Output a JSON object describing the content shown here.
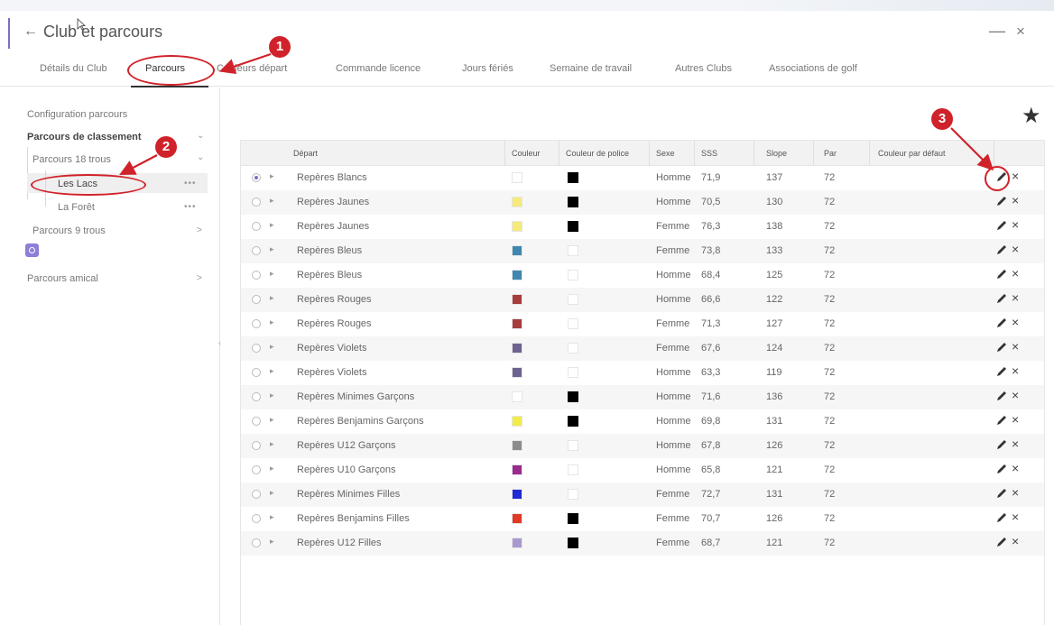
{
  "window": {
    "title": "Club et parcours",
    "back_icon": "arrow-left-icon",
    "minimize_label": "—",
    "close_label": "×"
  },
  "tabs": [
    {
      "label": "Détails du Club",
      "active": false
    },
    {
      "label": "Parcours",
      "active": true
    },
    {
      "label": "Couleurs départ",
      "active": false
    },
    {
      "label": "Commande licence",
      "active": false
    },
    {
      "label": "Jours fériés",
      "active": false
    },
    {
      "label": "Semaine de travail",
      "active": false
    },
    {
      "label": "Autres Clubs",
      "active": false
    },
    {
      "label": "Associations de golf",
      "active": false
    }
  ],
  "sidebar": {
    "heading": "Configuration parcours",
    "items": [
      {
        "label": "Parcours de classement",
        "chevron": "⌄"
      },
      {
        "label": "Parcours 18 trous",
        "chevron": "⌄"
      },
      {
        "label": "Les Lacs",
        "dots": "•••",
        "selected": true
      },
      {
        "label": "La Forêt",
        "dots": "•••"
      },
      {
        "label": "Parcours 9 trous",
        "chevron": ">"
      },
      {
        "label": "Parcours amical",
        "chevron": ">"
      }
    ]
  },
  "table": {
    "headers": [
      "Départ",
      "Couleur",
      "Couleur de police",
      "Sexe",
      "SSS",
      "Slope",
      "Par",
      "Couleur par défaut"
    ],
    "rows": [
      {
        "depart": "Repères Blancs",
        "couleur": "#ffffff",
        "police": "#000000",
        "sexe": "Homme",
        "sss": "71,9",
        "slope": "137",
        "par": "72",
        "checked": true
      },
      {
        "depart": "Repères Jaunes",
        "couleur": "#f5ea7a",
        "police": "#000000",
        "sexe": "Homme",
        "sss": "70,5",
        "slope": "130",
        "par": "72",
        "checked": false
      },
      {
        "depart": "Repères Jaunes",
        "couleur": "#f5ea7a",
        "police": "#000000",
        "sexe": "Femme",
        "sss": "76,3",
        "slope": "138",
        "par": "72",
        "checked": false
      },
      {
        "depart": "Repères Bleus",
        "couleur": "#3f87b0",
        "police": "#ffffff",
        "sexe": "Femme",
        "sss": "73,8",
        "slope": "133",
        "par": "72",
        "checked": false
      },
      {
        "depart": "Repères Bleus",
        "couleur": "#3f87b0",
        "police": "#ffffff",
        "sexe": "Homme",
        "sss": "68,4",
        "slope": "125",
        "par": "72",
        "checked": false
      },
      {
        "depart": "Repères Rouges",
        "couleur": "#a83c3c",
        "police": "#ffffff",
        "sexe": "Homme",
        "sss": "66,6",
        "slope": "122",
        "par": "72",
        "checked": false
      },
      {
        "depart": "Repères Rouges",
        "couleur": "#a83c3c",
        "police": "#ffffff",
        "sexe": "Femme",
        "sss": "71,3",
        "slope": "127",
        "par": "72",
        "checked": false
      },
      {
        "depart": "Repères Violets",
        "couleur": "#6e6390",
        "police": "#ffffff",
        "sexe": "Femme",
        "sss": "67,6",
        "slope": "124",
        "par": "72",
        "checked": false
      },
      {
        "depart": "Repères Violets",
        "couleur": "#6e6390",
        "police": "#ffffff",
        "sexe": "Homme",
        "sss": "63,3",
        "slope": "119",
        "par": "72",
        "checked": false
      },
      {
        "depart": "Repères Minimes Garçons",
        "couleur": "#ffffff",
        "police": "#000000",
        "sexe": "Homme",
        "sss": "71,6",
        "slope": "136",
        "par": "72",
        "checked": false
      },
      {
        "depart": "Repères Benjamins Garçons",
        "couleur": "#f2ec4a",
        "police": "#000000",
        "sexe": "Homme",
        "sss": "69,8",
        "slope": "131",
        "par": "72",
        "checked": false
      },
      {
        "depart": "Repères U12 Garçons",
        "couleur": "#8c8c8c",
        "police": "#ffffff",
        "sexe": "Homme",
        "sss": "67,8",
        "slope": "126",
        "par": "72",
        "checked": false
      },
      {
        "depart": "Repères U10 Garçons",
        "couleur": "#9a2a8e",
        "police": "#ffffff",
        "sexe": "Homme",
        "sss": "65,8",
        "slope": "121",
        "par": "72",
        "checked": false
      },
      {
        "depart": "Repères Minimes Filles",
        "couleur": "#1f2ad4",
        "police": "#ffffff",
        "sexe": "Femme",
        "sss": "72,7",
        "slope": "131",
        "par": "72",
        "checked": false
      },
      {
        "depart": "Repères Benjamins Filles",
        "couleur": "#e03a26",
        "police": "#000000",
        "sexe": "Femme",
        "sss": "70,7",
        "slope": "126",
        "par": "72",
        "checked": false
      },
      {
        "depart": "Repères U12 Filles",
        "couleur": "#a89ad0",
        "police": "#000000",
        "sexe": "Femme",
        "sss": "68,7",
        "slope": "121",
        "par": "72",
        "checked": false
      }
    ],
    "edit_icon": "pencil-icon",
    "delete_label": "×"
  },
  "favorite_label": "★",
  "annotations": [
    "1",
    "2",
    "3"
  ],
  "colors": {
    "accent": "#7c6dc9",
    "annotation": "#d0222a"
  }
}
